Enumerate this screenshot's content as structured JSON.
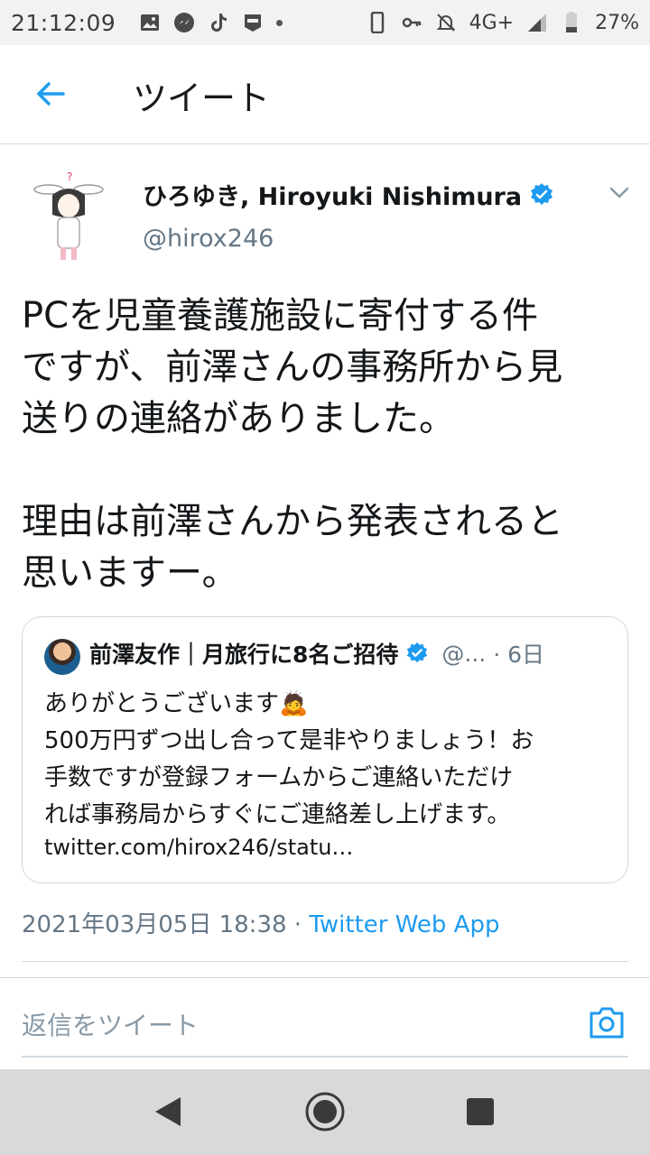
{
  "status_bar": {
    "time": "21:12:09",
    "network": "4G+",
    "battery": "27%",
    "left_icons": [
      "image-icon",
      "messenger-icon",
      "tiktok-icon",
      "app-badge-icon",
      "notification-dot-icon"
    ],
    "right_icons": [
      "phone-icon",
      "key-icon",
      "bell-off-icon",
      "signal-icon",
      "battery-icon"
    ]
  },
  "header": {
    "title": "ツイート",
    "back_icon": "arrow-left-icon"
  },
  "tweet": {
    "author_name": "ひろゆき, Hiroyuki Nishimura",
    "handle": "@hirox246",
    "text": "PCを児童養護施設に寄付する件\nですが、前澤さんの事務所から見\n送りの連絡がありました。\n\n理由は前澤さんから発表されると\n思いますー。",
    "timestamp": "2021年03月05日 18:38",
    "separator": " · ",
    "client": "Twitter Web App"
  },
  "quoted_tweet": {
    "author_name": "前澤友作｜月旅行に8名ご招待",
    "handle": "@...",
    "time": "· 6日",
    "text": "ありがとうございます🙇\n500万円ずつ出し合って是非やりましょう！お\n手数ですが登録フォームからご連絡いただけ\nれば事務局からすぐにご連絡差し上げます。",
    "link": "twitter.com/hirox246/statu…"
  },
  "reply": {
    "placeholder": "返信をツイート",
    "camera_icon": "camera-icon"
  },
  "colors": {
    "accent": "#1d9bf0",
    "muted": "#657786",
    "border": "#cfd9de",
    "nav_bg": "#d9d9d9"
  }
}
